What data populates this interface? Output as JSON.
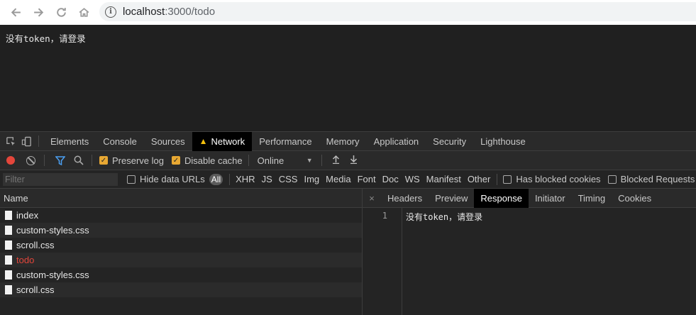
{
  "browser": {
    "url_host": "localhost",
    "url_path": ":3000/todo"
  },
  "page": {
    "message": "没有token，请登录"
  },
  "devtools": {
    "tabs": [
      "Elements",
      "Console",
      "Sources",
      "Network",
      "Performance",
      "Memory",
      "Application",
      "Security",
      "Lighthouse"
    ],
    "active_tab": "Network",
    "toolbar": {
      "preserve_log": "Preserve log",
      "disable_cache": "Disable cache",
      "throttle": "Online"
    },
    "filter": {
      "placeholder": "Filter",
      "hide_data_urls": "Hide data URLs",
      "types": [
        "All",
        "XHR",
        "JS",
        "CSS",
        "Img",
        "Media",
        "Font",
        "Doc",
        "WS",
        "Manifest",
        "Other"
      ],
      "has_blocked_cookies": "Has blocked cookies",
      "blocked_requests": "Blocked Requests"
    },
    "requests": {
      "header": "Name",
      "rows": [
        "index",
        "custom-styles.css",
        "scroll.css",
        "todo",
        "custom-styles.css",
        "scroll.css"
      ]
    },
    "detail": {
      "close": "×",
      "tabs": [
        "Headers",
        "Preview",
        "Response",
        "Initiator",
        "Timing",
        "Cookies"
      ],
      "active_tab": "Response",
      "line_number": "1",
      "response_body": "没有token，请登录"
    }
  },
  "colors": {
    "record": "#e4463b",
    "error_text": "#e2453a",
    "checkbox": "#e8a833",
    "warning": "#f4c00c"
  }
}
